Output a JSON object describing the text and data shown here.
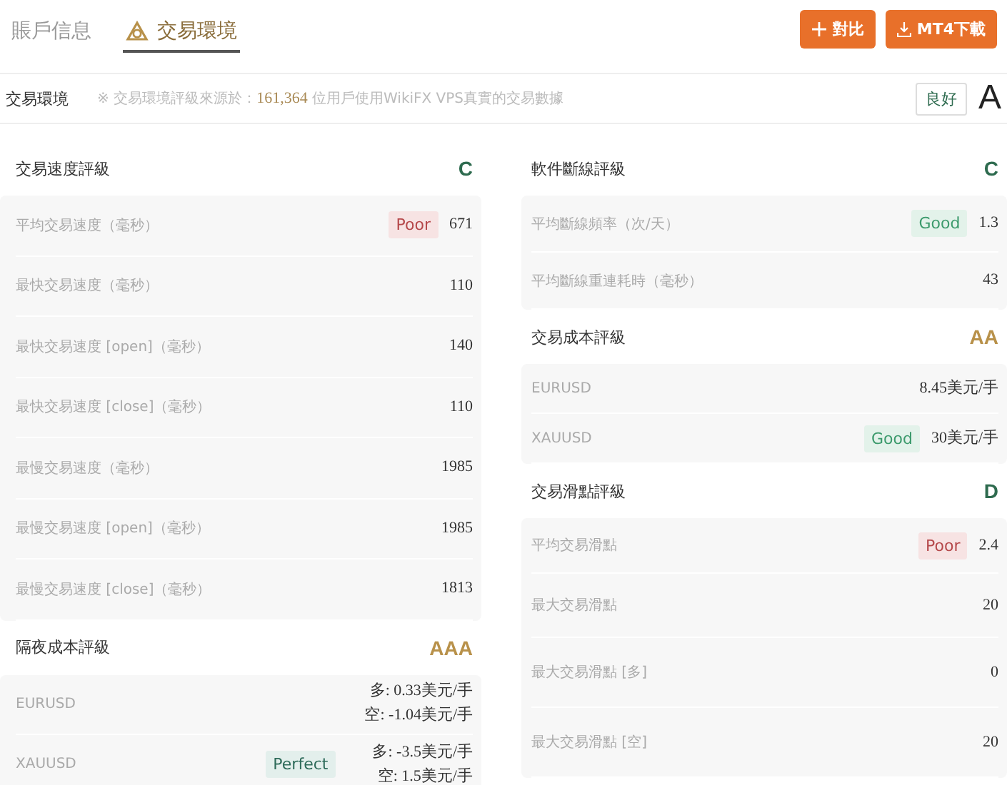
{
  "tabs": [
    {
      "label": "賬戶信息",
      "selected": false
    },
    {
      "label": "交易環境",
      "selected": true
    }
  ],
  "buttons": [
    {
      "kind": "compare",
      "label": "對比"
    },
    {
      "kind": "download",
      "label": "MT4下載"
    }
  ],
  "summary": {
    "title": "交易環境",
    "note_prefix": "※ 交易環境評級來源於：",
    "count": "161,364",
    "note_suffix": " 位用戶使用WikiFX VPS真實的交易數據",
    "rating_label": "良好",
    "grade": "A"
  },
  "columns": [
    {
      "sections": [
        {
          "title": "交易速度評級",
          "grade": "C",
          "color": "#2e6b4f",
          "rows": [
            {
              "label": "平均交易速度（毫秒）",
              "badge": {
                "text": "Poor",
                "kind": "poor"
              },
              "values": [
                "671"
              ]
            },
            {
              "label": "最快交易速度（毫秒）",
              "values": [
                "110"
              ]
            },
            {
              "label": "最快交易速度 [open]（毫秒）",
              "values": [
                "140"
              ]
            },
            {
              "label": "最快交易速度 [close]（毫秒）",
              "values": [
                "110"
              ]
            },
            {
              "label": "最慢交易速度（毫秒）",
              "values": [
                "1985"
              ]
            },
            {
              "label": "最慢交易速度 [open]（毫秒）",
              "values": [
                "1985"
              ]
            },
            {
              "label": "最慢交易速度 [close]（毫秒）",
              "values": [
                "1813"
              ]
            }
          ]
        },
        {
          "title": "隔夜成本評級",
          "grade": "AAA",
          "color": "#b8914a",
          "rows": [
            {
              "label": "EURUSD",
              "values": [
                "多: 0.33美元/手",
                "空: -1.04美元/手"
              ]
            },
            {
              "label": "XAUUSD",
              "badge": {
                "text": "Perfect",
                "kind": "perfect"
              },
              "values": [
                "多: -3.5美元/手",
                "空: 1.5美元/手"
              ]
            }
          ]
        }
      ]
    },
    {
      "sections": [
        {
          "title": "軟件斷線評級",
          "grade": "C",
          "color": "#2e6b4f",
          "rows": [
            {
              "label": "平均斷線頻率（次/天）",
              "badge": {
                "text": "Good",
                "kind": "good"
              },
              "values": [
                "1.3"
              ]
            },
            {
              "label": "平均斷線重連耗時（毫秒）",
              "values": [
                "43"
              ]
            }
          ]
        },
        {
          "title": "交易成本評級",
          "grade": "AA",
          "color": "#b8914a",
          "rows": [
            {
              "label": "EURUSD",
              "values": [
                "8.45美元/手"
              ]
            },
            {
              "label": "XAUUSD",
              "badge": {
                "text": "Good",
                "kind": "good"
              },
              "values": [
                "30美元/手"
              ]
            }
          ]
        },
        {
          "title": "交易滑點評級",
          "grade": "D",
          "color": "#2e6b4f",
          "rows": [
            {
              "label": "平均交易滑點",
              "badge": {
                "text": "Poor",
                "kind": "poor"
              },
              "values": [
                "2.4"
              ]
            },
            {
              "label": "最大交易滑點",
              "values": [
                "20"
              ]
            },
            {
              "label": "最大交易滑點 [多]",
              "values": [
                "0"
              ]
            },
            {
              "label": "最大交易滑點 [空]",
              "values": [
                "20"
              ]
            }
          ]
        }
      ]
    }
  ]
}
